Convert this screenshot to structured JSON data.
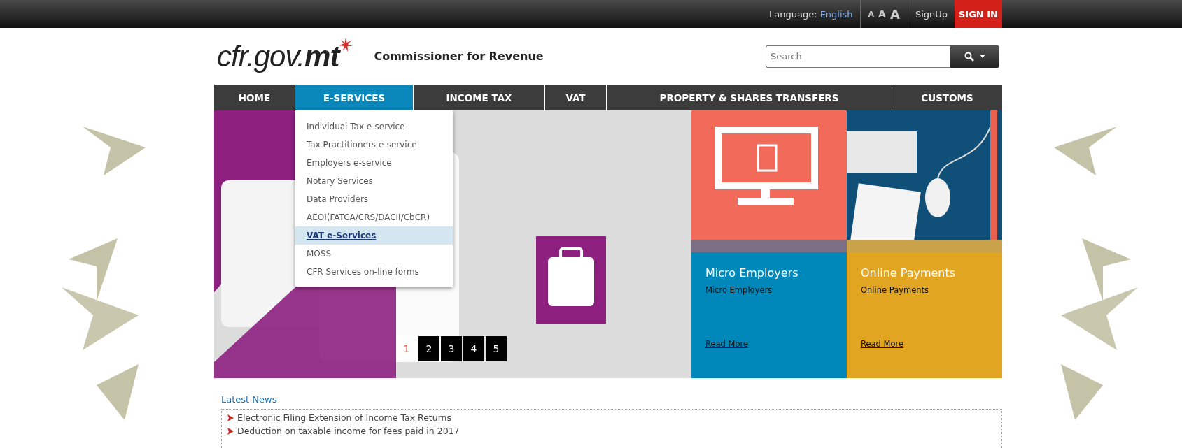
{
  "top_bar": {
    "language_label": "Language:",
    "language": "English",
    "font_size_buttons": [
      "A",
      "A",
      "A"
    ],
    "signup": "SignUp",
    "signin": "SIGN IN"
  },
  "header": {
    "logo": "cfr.gov.**mt**",
    "title": "Commissioner for Revenue",
    "search": {
      "placeholder": "Search"
    }
  },
  "nav": [
    {
      "label": "HOME",
      "selected": false
    },
    {
      "label": "E-SERVICES",
      "selected": true,
      "expanded": true,
      "menu": [
        {
          "label": "Individual Tax e-service",
          "selected": false
        },
        {
          "label": "Tax Practitioners e-service",
          "selected": false
        },
        {
          "label": "Employers e-service",
          "selected": false
        },
        {
          "label": "Notary Services",
          "selected": false
        },
        {
          "label": "Data Providers",
          "selected": false
        },
        {
          "label": "AEOI(FATCA/CRS/DACII/CbCR)",
          "selected": false
        },
        {
          "label": "VAT e-Services",
          "selected": true
        },
        {
          "label": "MOSS",
          "selected": false
        },
        {
          "label": "CFR Services on-line forms",
          "selected": false
        }
      ]
    },
    {
      "label": "INCOME TAX",
      "selected": false
    },
    {
      "label": "VAT",
      "selected": false
    },
    {
      "label": "PROPERTY & SHARES TRANSFERS",
      "selected": false
    },
    {
      "label": "CUSTOMS",
      "selected": false
    }
  ],
  "slider": {
    "pages": [
      {
        "label": "1",
        "selected": true
      },
      {
        "label": "2",
        "selected": false
      },
      {
        "label": "3",
        "selected": false
      },
      {
        "label": "4",
        "selected": false
      },
      {
        "label": "5",
        "selected": false
      }
    ]
  },
  "tiles": [
    {
      "kind": "monitor",
      "title": "Micro Employers",
      "subtitle": "Micro Employers",
      "link": "Read More",
      "color": "#0088bb"
    },
    {
      "kind": "desk",
      "title": "Online Payments",
      "subtitle": "Online Payments",
      "link": "Read More",
      "color": "#e2a522"
    }
  ],
  "news": {
    "title": "Latest News",
    "items": [
      "Electronic Filing Extension of Income Tax Returns",
      "Deduction on taxable income for fees paid in 2017"
    ]
  }
}
